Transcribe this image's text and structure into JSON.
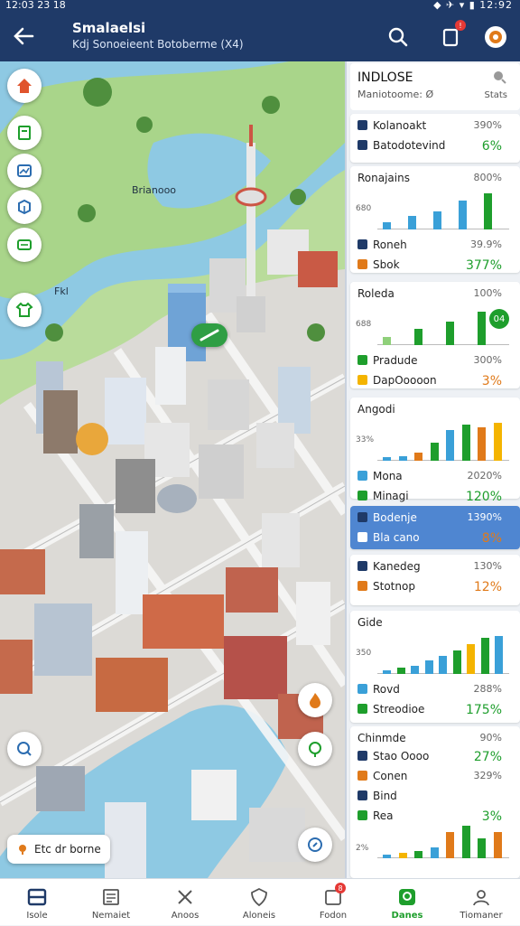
{
  "status_bar": {
    "time": "12:03 23 18",
    "icons": "◆ ✈ ▾ ▮ 12:92"
  },
  "header": {
    "title": "Smalaelsi",
    "subtitle": "Kdj Sonoeieent Botoberme (X4)"
  },
  "map": {
    "labels": [
      "Brianooo",
      "Fkl"
    ],
    "location_chip": "Etc dr borne"
  },
  "panel": {
    "title": "INDLOSE",
    "subtitle": "Maniotoome: Ø",
    "stats_label": "Stats",
    "cards": [
      {
        "rows": [
          {
            "label": "Kolanoakt",
            "value": "390%",
            "icon_color": "#1f3a68"
          },
          {
            "label": "Batodotevind",
            "value": "6%",
            "icon_color": "#1f3a68",
            "big": true,
            "tone": "green"
          }
        ]
      },
      {
        "title": "Ronajains",
        "percent": "800%",
        "axis": "680",
        "bars": [
          {
            "v": 0.18,
            "c": "#3aa0d8"
          },
          {
            "v": 0.35,
            "c": "#3aa0d8"
          },
          {
            "v": 0.45,
            "c": "#3aa0d8"
          },
          {
            "v": 0.72,
            "c": "#3aa0d8"
          },
          {
            "v": 0.9,
            "c": "#1e9e2c"
          }
        ],
        "rows": [
          {
            "label": "Roneh",
            "value": "39.9%",
            "icon_color": "#1f3a68"
          },
          {
            "label": "Sbok",
            "value": "377%",
            "icon_color": "#e07a1a",
            "big": true,
            "tone": "green"
          }
        ]
      },
      {
        "title": "Roleda",
        "percent": "100%",
        "axis": "688",
        "bars": [
          {
            "v": 0.2,
            "c": "#8fd07a"
          },
          {
            "v": 0.42,
            "c": "#1e9e2c"
          },
          {
            "v": 0.6,
            "c": "#1e9e2c"
          },
          {
            "v": 0.85,
            "c": "#1e9e2c"
          }
        ],
        "badge": "04",
        "rows": [
          {
            "label": "Pradude",
            "value": "300%",
            "icon_color": "#1e9e2c"
          },
          {
            "label": "DapOoooon",
            "value": "3%",
            "icon_color": "#f4b400",
            "big": true,
            "tone": "orange"
          }
        ]
      },
      {
        "title": "Angodi",
        "axis": "33%",
        "bars": [
          {
            "v": 0.08,
            "c": "#3aa0d8"
          },
          {
            "v": 0.12,
            "c": "#3aa0d8"
          },
          {
            "v": 0.2,
            "c": "#e07a1a"
          },
          {
            "v": 0.45,
            "c": "#1e9e2c"
          },
          {
            "v": 0.78,
            "c": "#3aa0d8"
          },
          {
            "v": 0.9,
            "c": "#1e9e2c"
          },
          {
            "v": 0.85,
            "c": "#e07a1a"
          },
          {
            "v": 0.95,
            "c": "#f4b400"
          }
        ],
        "rows": [
          {
            "label": "Mona",
            "value": "2020%",
            "icon_color": "#3aa0d8"
          },
          {
            "label": "Minagi",
            "value": "120%",
            "icon_color": "#1e9e2c",
            "big": true,
            "tone": "green"
          }
        ]
      },
      {
        "active": true,
        "rows": [
          {
            "label": "Bodenje",
            "value": "1390%",
            "icon_color": "#1f3a68"
          },
          {
            "label": "Bla cano",
            "value": "8%",
            "icon_color": "#fff",
            "big": true,
            "tone": "orange"
          }
        ]
      },
      {
        "rows": [
          {
            "label": "Kanedeg",
            "value": "130%",
            "icon_color": "#1f3a68"
          },
          {
            "label": "Stotnop",
            "value": "12%",
            "icon_color": "#e07a1a",
            "big": true,
            "tone": "orange"
          }
        ]
      },
      {
        "title": "Gide",
        "axis": "350",
        "bars": [
          {
            "v": 0.08,
            "c": "#3aa0d8"
          },
          {
            "v": 0.15,
            "c": "#1e9e2c"
          },
          {
            "v": 0.2,
            "c": "#3aa0d8"
          },
          {
            "v": 0.35,
            "c": "#3aa0d8"
          },
          {
            "v": 0.45,
            "c": "#3aa0d8"
          },
          {
            "v": 0.6,
            "c": "#1e9e2c"
          },
          {
            "v": 0.75,
            "c": "#f4b400"
          },
          {
            "v": 0.9,
            "c": "#1e9e2c"
          },
          {
            "v": 0.95,
            "c": "#3aa0d8"
          }
        ],
        "rows": [
          {
            "label": "Rovd",
            "value": "288%",
            "icon_color": "#3aa0d8"
          },
          {
            "label": "Streodioe",
            "value": "175%",
            "icon_color": "#1e9e2c",
            "big": true,
            "tone": "green"
          }
        ]
      },
      {
        "title": "Chinmde",
        "percent": "90%",
        "rows": [
          {
            "label": "Stao Oooo",
            "value": "27%",
            "icon_color": "#1f3a68",
            "big": true,
            "tone": "green"
          },
          {
            "label": "Conen",
            "value": "329%",
            "icon_color": "#e07a1a"
          },
          {
            "label": "Bind",
            "value": "",
            "icon_color": "#1f3a68"
          },
          {
            "label": "Rea",
            "value": "3%",
            "icon_color": "#1e9e2c",
            "big": true,
            "tone": "green"
          }
        ],
        "axis": "2%",
        "bars": [
          {
            "v": 0.1,
            "c": "#3aa0d8"
          },
          {
            "v": 0.15,
            "c": "#f4b400"
          },
          {
            "v": 0.2,
            "c": "#1e9e2c"
          },
          {
            "v": 0.3,
            "c": "#3aa0d8"
          },
          {
            "v": 0.72,
            "c": "#e07a1a"
          },
          {
            "v": 0.9,
            "c": "#1e9e2c"
          },
          {
            "v": 0.55,
            "c": "#1e9e2c"
          },
          {
            "v": 0.72,
            "c": "#e07a1a"
          }
        ]
      }
    ]
  },
  "nav": {
    "items": [
      {
        "label": "Isole",
        "icon": "grid-icon",
        "active": false
      },
      {
        "label": "Nemaiet",
        "icon": "news-icon",
        "active": false
      },
      {
        "label": "Anoos",
        "icon": "tools-icon",
        "active": false
      },
      {
        "label": "Aloneis",
        "icon": "shield-icon",
        "active": false
      },
      {
        "label": "Fodon",
        "icon": "inbox-icon",
        "active": false,
        "badge": "8"
      },
      {
        "label": "Danes",
        "icon": "map-icon",
        "active": true
      },
      {
        "label": "Tiomaner",
        "icon": "profile-icon",
        "active": false
      }
    ]
  },
  "colors": {
    "brand": "#1f3a68",
    "green": "#1e9e2c",
    "blue": "#3aa0d8",
    "orange": "#e07a1a",
    "yellow": "#f4b400"
  }
}
